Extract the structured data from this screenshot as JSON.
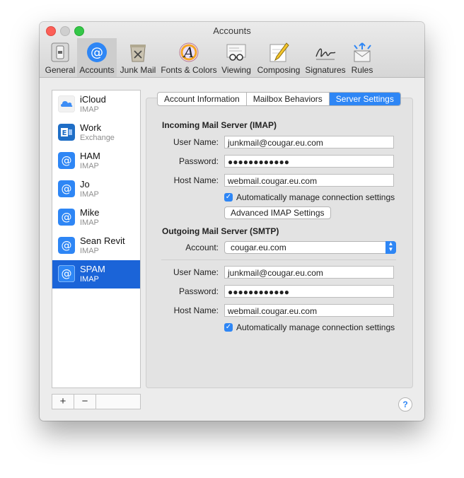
{
  "window": {
    "title": "Accounts"
  },
  "toolbar": {
    "items": [
      {
        "label": "General",
        "icon": "general-icon"
      },
      {
        "label": "Accounts",
        "icon": "accounts-icon"
      },
      {
        "label": "Junk Mail",
        "icon": "junk-mail-icon"
      },
      {
        "label": "Fonts & Colors",
        "icon": "fonts-colors-icon"
      },
      {
        "label": "Viewing",
        "icon": "viewing-icon"
      },
      {
        "label": "Composing",
        "icon": "composing-icon"
      },
      {
        "label": "Signatures",
        "icon": "signatures-icon"
      },
      {
        "label": "Rules",
        "icon": "rules-icon"
      }
    ],
    "selected": "Accounts"
  },
  "accounts": [
    {
      "name": "iCloud",
      "type": "IMAP",
      "icon": "icloud-icon"
    },
    {
      "name": "Work",
      "type": "Exchange",
      "icon": "exchange-icon"
    },
    {
      "name": "HAM",
      "type": "IMAP",
      "icon": "at-icon"
    },
    {
      "name": "Jo",
      "type": "IMAP",
      "icon": "at-icon"
    },
    {
      "name": "Mike",
      "type": "IMAP",
      "icon": "at-icon"
    },
    {
      "name": "Sean Revit",
      "type": "IMAP",
      "icon": "at-icon"
    },
    {
      "name": "SPAM",
      "type": "IMAP",
      "icon": "at-icon"
    }
  ],
  "list_buttons": {
    "add": "+",
    "remove": "−"
  },
  "tabs": [
    "Account Information",
    "Mailbox Behaviors",
    "Server Settings"
  ],
  "selected_tab": "Server Settings",
  "incoming": {
    "heading": "Incoming Mail Server (IMAP)",
    "user_label": "User Name:",
    "user_value": "junkmail@cougar.eu.com",
    "password_label": "Password:",
    "password_value": "●●●●●●●●●●●●",
    "host_label": "Host Name:",
    "host_value": "webmail.cougar.eu.com",
    "auto_manage": "Automatically manage connection settings",
    "advanced_button": "Advanced IMAP Settings"
  },
  "outgoing": {
    "heading": "Outgoing Mail Server (SMTP)",
    "account_label": "Account:",
    "account_value": "cougar.eu.com",
    "user_label": "User Name:",
    "user_value": "junkmail@cougar.eu.com",
    "password_label": "Password:",
    "password_value": "●●●●●●●●●●●●",
    "host_label": "Host Name:",
    "host_value": "webmail.cougar.eu.com",
    "auto_manage": "Automatically manage connection settings"
  },
  "help": "?",
  "colors": {
    "accent": "#2e86f5",
    "selection": "#1b64d8"
  }
}
